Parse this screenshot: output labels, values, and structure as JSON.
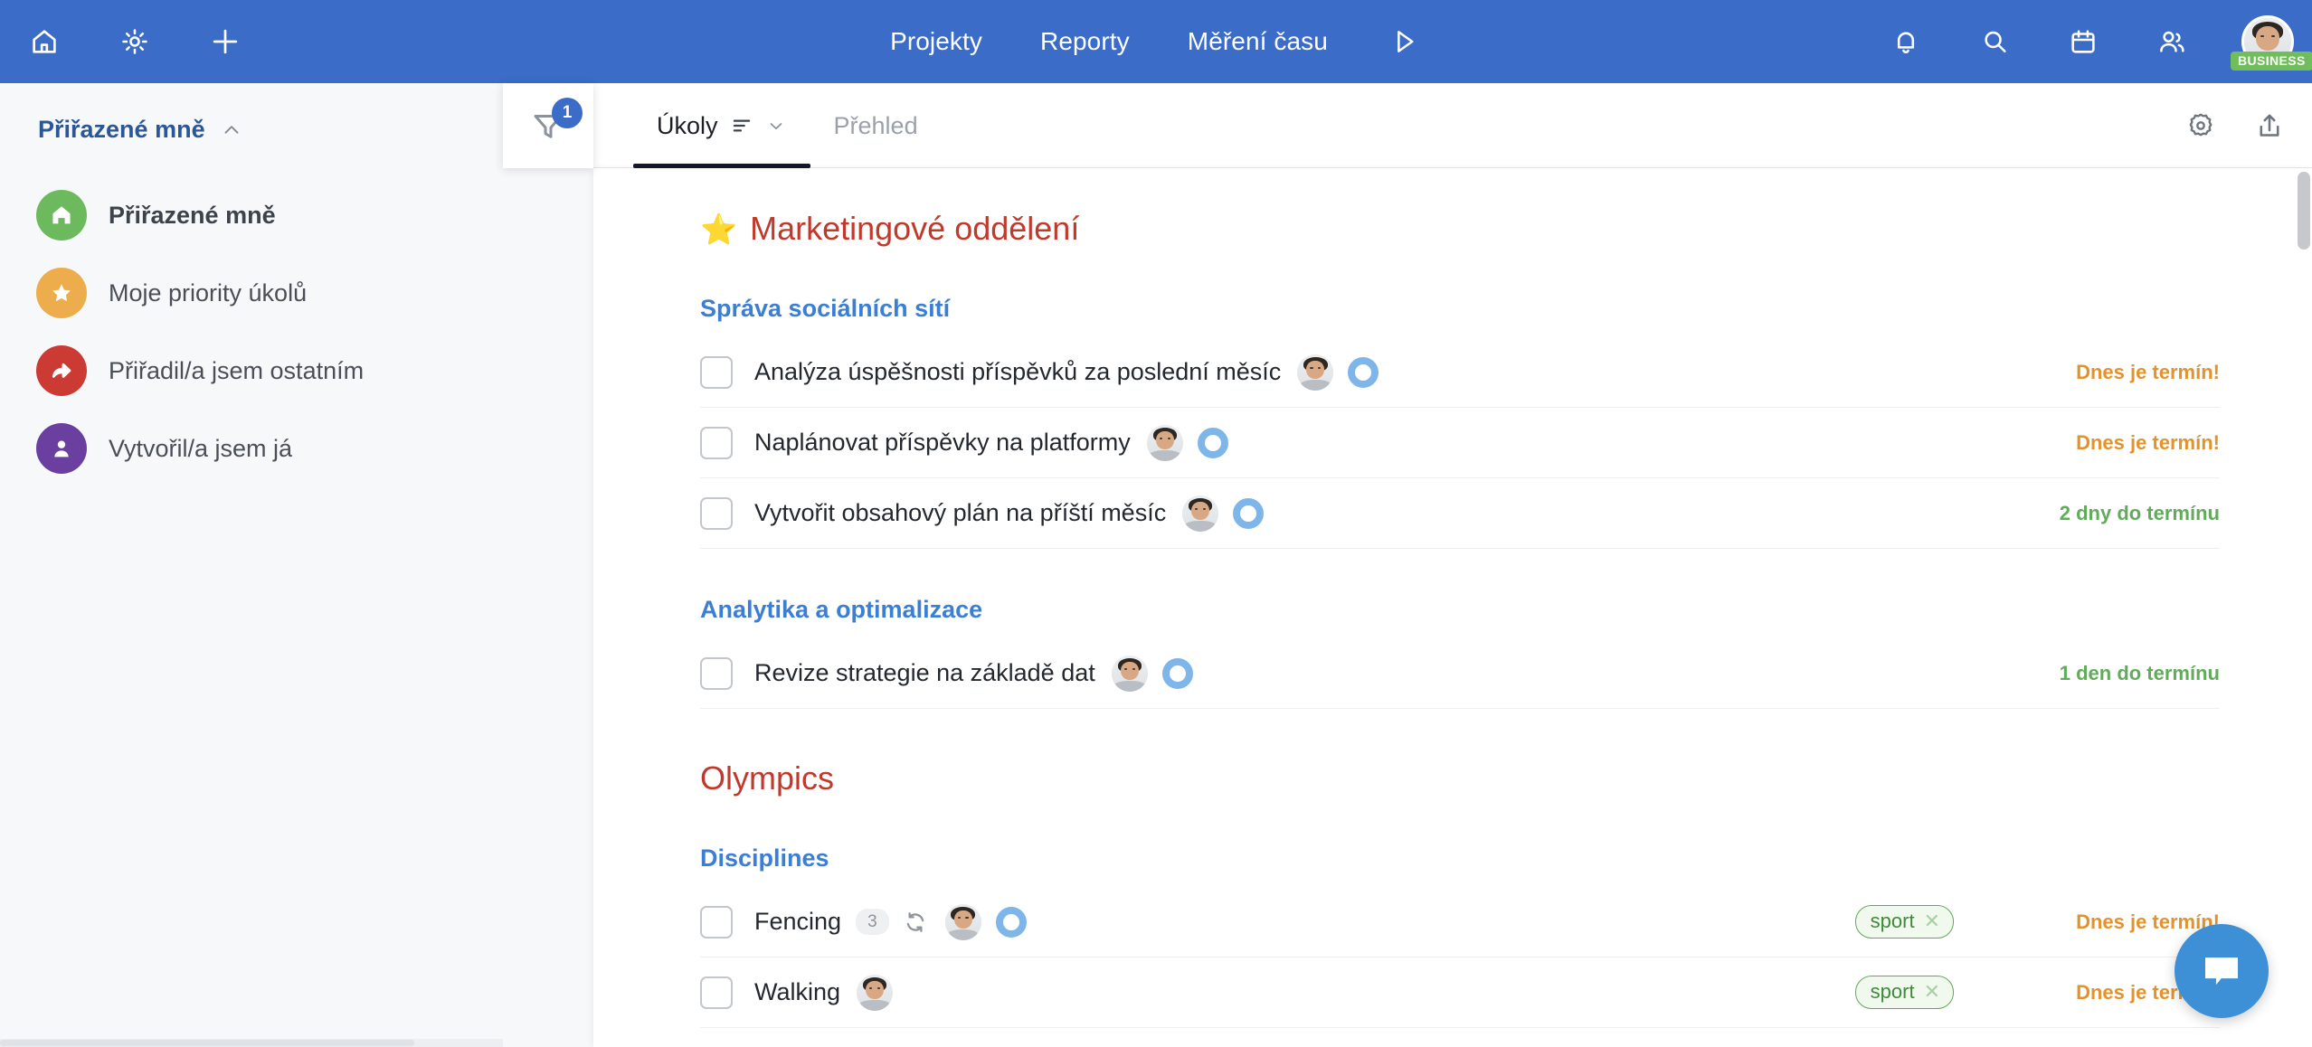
{
  "topnav": {
    "bg_color": "#3a6cc8",
    "left_icons": [
      {
        "name": "home-icon",
        "label": "Home"
      },
      {
        "name": "settings-gear-icon",
        "label": "Settings"
      },
      {
        "name": "plus-add-icon",
        "label": "Add"
      }
    ],
    "links": [
      {
        "label": "Projekty"
      },
      {
        "label": "Reporty"
      },
      {
        "label": "Měření času"
      }
    ],
    "play_icon": "play-timer-icon",
    "right_icons": [
      {
        "name": "bell-notification-icon"
      },
      {
        "name": "search-icon"
      },
      {
        "name": "calendar-icon"
      },
      {
        "name": "people-contacts-icon"
      }
    ],
    "avatar": {
      "name": "user-avatar",
      "badge": "BUSINESS",
      "badge_color": "#70bd5c"
    }
  },
  "sidebar": {
    "header": "Přiřazené mně",
    "items": [
      {
        "label": "Přiřazené mně",
        "icon": "home-icon",
        "color": "#6cba5d",
        "active": true
      },
      {
        "label": "Moje priority úkolů",
        "icon": "star-icon",
        "color": "#edad4c",
        "active": false
      },
      {
        "label": "Přiřadil/a jsem ostatním",
        "icon": "share-arrow-icon",
        "color": "#cb3b34",
        "active": false
      },
      {
        "label": "Vytvořil/a jsem já",
        "icon": "person-icon",
        "color": "#6a3fa0",
        "active": false
      }
    ]
  },
  "toolbar": {
    "filter": {
      "icon": "filter-funnel-icon",
      "badge": "1"
    },
    "tabs": [
      {
        "label": "Úkoly",
        "active": true,
        "has_sort_icon": true,
        "has_chevron": true
      },
      {
        "label": "Přehled",
        "active": false
      }
    ],
    "right_icons": [
      {
        "name": "settings-flower-icon"
      },
      {
        "name": "share-export-icon"
      }
    ]
  },
  "content": {
    "projects": [
      {
        "title": "Marketingové oddělení",
        "starred": true,
        "star_glyph": "⭐",
        "color": "#c0392b",
        "sections": [
          {
            "title": "Správa sociálních sítí",
            "tasks": [
              {
                "title": "Analýza úspěšnosti příspěvků za poslední měsíc",
                "assignee": "user-avatar",
                "status_ring": "#7fb6e9",
                "due": "Dnes je termín!",
                "due_state": "warn",
                "tag": null,
                "subtasks": null,
                "recurring": false
              },
              {
                "title": "Naplánovat příspěvky na platformy",
                "assignee": "user-avatar",
                "status_ring": "#7fb6e9",
                "due": "Dnes je termín!",
                "due_state": "warn",
                "tag": null,
                "subtasks": null,
                "recurring": false
              },
              {
                "title": "Vytvořit obsahový plán na příští měsíc",
                "assignee": "user-avatar",
                "status_ring": "#7fb6e9",
                "due": "2 dny do termínu",
                "due_state": "ok",
                "tag": null,
                "subtasks": null,
                "recurring": false
              }
            ]
          },
          {
            "title": "Analytika a optimalizace",
            "tasks": [
              {
                "title": "Revize strategie na základě dat",
                "assignee": "user-avatar",
                "status_ring": "#7fb6e9",
                "due": "1 den do termínu",
                "due_state": "ok",
                "tag": null,
                "subtasks": null,
                "recurring": false
              }
            ]
          }
        ]
      },
      {
        "title": "Olympics",
        "starred": false,
        "star_glyph": "",
        "color": "#c0392b",
        "sections": [
          {
            "title": "Disciplines",
            "tasks": [
              {
                "title": "Fencing",
                "assignee": "user-avatar",
                "status_ring": "#7fb6e9",
                "due": "Dnes je termín!",
                "due_state": "warn",
                "tag": "sport",
                "subtasks": "3",
                "recurring": true
              },
              {
                "title": "Walking",
                "assignee": "user-avatar",
                "status_ring": null,
                "due": "Dnes je termín!",
                "due_state": "warn",
                "tag": "sport",
                "subtasks": null,
                "recurring": false
              }
            ]
          }
        ]
      }
    ]
  },
  "fab": {
    "name": "chat-bubble-icon",
    "color": "#3d8fd6"
  }
}
